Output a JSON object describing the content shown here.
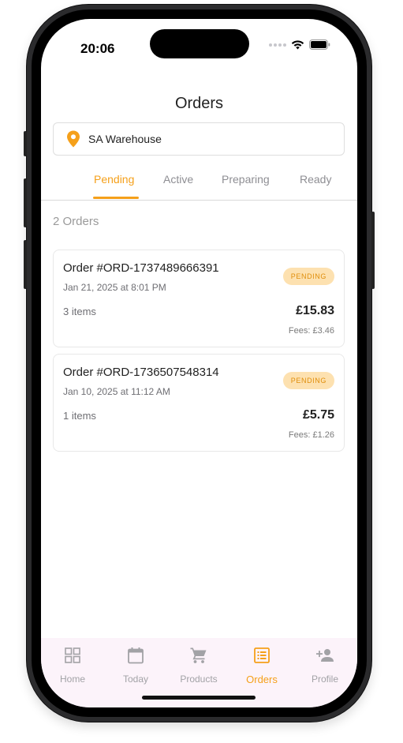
{
  "status_bar": {
    "time": "20:06"
  },
  "header": {
    "title": "Orders"
  },
  "location": {
    "name": "SA Warehouse",
    "icon": "location-pin-icon"
  },
  "tabs": [
    {
      "label": "Pending",
      "active": true
    },
    {
      "label": "Active",
      "active": false
    },
    {
      "label": "Preparing",
      "active": false
    },
    {
      "label": "Ready",
      "active": false
    }
  ],
  "orders_count": "2 Orders",
  "orders": [
    {
      "id": "Order #ORD-1737489666391",
      "date": "Jan 21, 2025 at 8:01 PM",
      "status": "PENDING",
      "items": "3 items",
      "total": "£15.83",
      "fees": "Fees: £3.46"
    },
    {
      "id": "Order #ORD-1736507548314",
      "date": "Jan 10, 2025 at 11:12 AM",
      "status": "PENDING",
      "items": "1 items",
      "total": "£5.75",
      "fees": "Fees: £1.26"
    }
  ],
  "bottom_nav": [
    {
      "label": "Home",
      "icon": "grid-icon",
      "active": false
    },
    {
      "label": "Today",
      "icon": "calendar-icon",
      "active": false
    },
    {
      "label": "Products",
      "icon": "cart-icon",
      "active": false
    },
    {
      "label": "Orders",
      "icon": "list-icon",
      "active": true
    },
    {
      "label": "Profile",
      "icon": "add-person-icon",
      "active": false
    }
  ],
  "colors": {
    "accent": "#f5a01a",
    "badge_bg": "#fde1b0",
    "nav_bg": "#fcf3fa",
    "inactive": "#a2a2a6"
  }
}
